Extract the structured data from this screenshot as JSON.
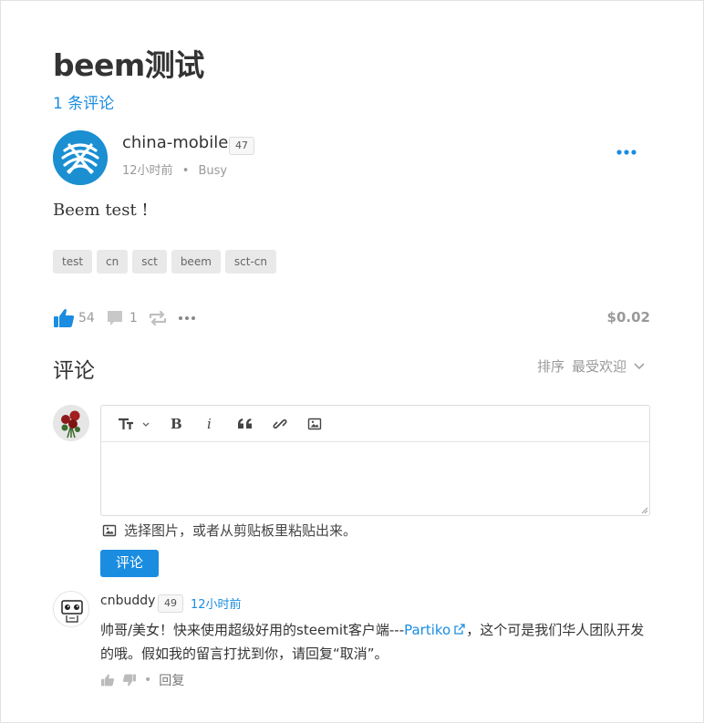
{
  "post": {
    "title": "beem测试",
    "comments_count": "1 条评论",
    "author": "china-mobile",
    "reputation": "47",
    "time": "12小时前",
    "separator": "•",
    "community": "Busy",
    "body": "Beem test !",
    "tags": [
      "test",
      "cn",
      "sct",
      "beem",
      "sct-cn"
    ],
    "votes": "54",
    "comment_count_short": "1",
    "payout": "$0.02"
  },
  "comments": {
    "heading": "评论",
    "sort_label": "排序",
    "sort_value": "最受欢迎"
  },
  "editor": {
    "insert_image_hint": "选择图片，或者从剪贴板里粘贴出来。",
    "submit_label": "评论"
  },
  "reply": {
    "author": "cnbuddy",
    "reputation": "49",
    "time": "12小时前",
    "text_before": "帅哥/美女！快来使用超级好用的steemit客户端---",
    "link_text": "Partiko",
    "text_after": "，这个可是我们华人团队开发的哦。假如我的留言打扰到你，请回复“取消”。",
    "separator": "•",
    "reply_label": "回复"
  },
  "colors": {
    "accent": "#1a8de0",
    "muted": "#999999",
    "text": "#333333"
  },
  "icons": [
    "more-icon",
    "like-icon",
    "comment-icon",
    "reblog-icon",
    "ellipsis-icon",
    "chevron-down-icon",
    "heading-icon",
    "bold-icon",
    "italic-icon",
    "quote-icon",
    "link-icon",
    "image-icon",
    "external-link-icon",
    "thumbs-up-icon",
    "thumbs-down-icon"
  ]
}
